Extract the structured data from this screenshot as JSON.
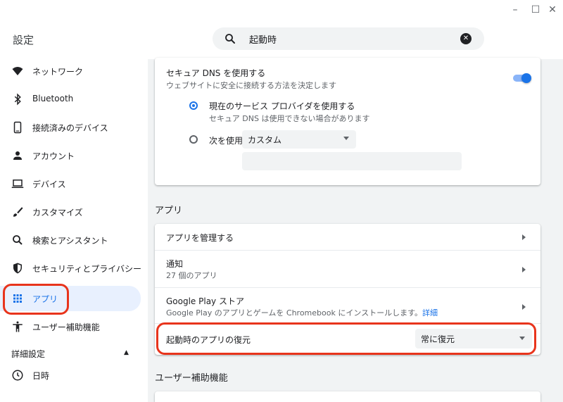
{
  "window": {
    "minimize_glyph": "–",
    "maximize_glyph": "☐",
    "close_glyph": "✕"
  },
  "app_title": "設定",
  "search": {
    "value": "起動時",
    "icon": "search-icon",
    "clear_icon": "clear-icon"
  },
  "sidebar": {
    "items": [
      {
        "label": "ネットワーク",
        "icon": "wifi-icon"
      },
      {
        "label": "Bluetooth",
        "icon": "bluetooth-icon"
      },
      {
        "label": "接続済みのデバイス",
        "icon": "phone-icon"
      },
      {
        "label": "アカウント",
        "icon": "person-icon"
      },
      {
        "label": "デバイス",
        "icon": "laptop-icon"
      },
      {
        "label": "カスタマイズ",
        "icon": "brush-icon"
      },
      {
        "label": "検索とアシスタント",
        "icon": "search-icon"
      },
      {
        "label": "セキュリティとプライバシー",
        "icon": "shield-icon"
      },
      {
        "label": "アプリ",
        "icon": "apps-grid-icon"
      },
      {
        "label": "ユーザー補助機能",
        "icon": "accessibility-icon"
      }
    ],
    "advanced_label": "詳細設定",
    "advanced_items": [
      {
        "label": "日時",
        "icon": "clock-icon"
      }
    ],
    "active_index": 8
  },
  "dns": {
    "title": "セキュア DNS を使用する",
    "subtitle": "ウェブサイトに安全に接続する方法を決定します",
    "enabled": true,
    "option1_title": "現在のサービス プロバイダを使用する",
    "option1_sub": "セキュア DNS は使用できない場合があります",
    "option2_label": "次を使用",
    "option2_select": "カスタム",
    "custom_input_value": ""
  },
  "apps_section": {
    "heading": "アプリ",
    "manage_label": "アプリを管理する",
    "notify_title": "通知",
    "notify_sub": "27 個のアプリ",
    "play_title": "Google Play ストア",
    "play_sub": "Google Play のアプリとゲームを Chromebook にインストールします。",
    "play_link": "詳細",
    "restore_label": "起動時のアプリの復元",
    "restore_value": "常に復元"
  },
  "accessibility_section": {
    "heading": "ユーザー補助機能"
  },
  "colors": {
    "accent": "#1a73e8",
    "highlight": "#e8341c"
  }
}
